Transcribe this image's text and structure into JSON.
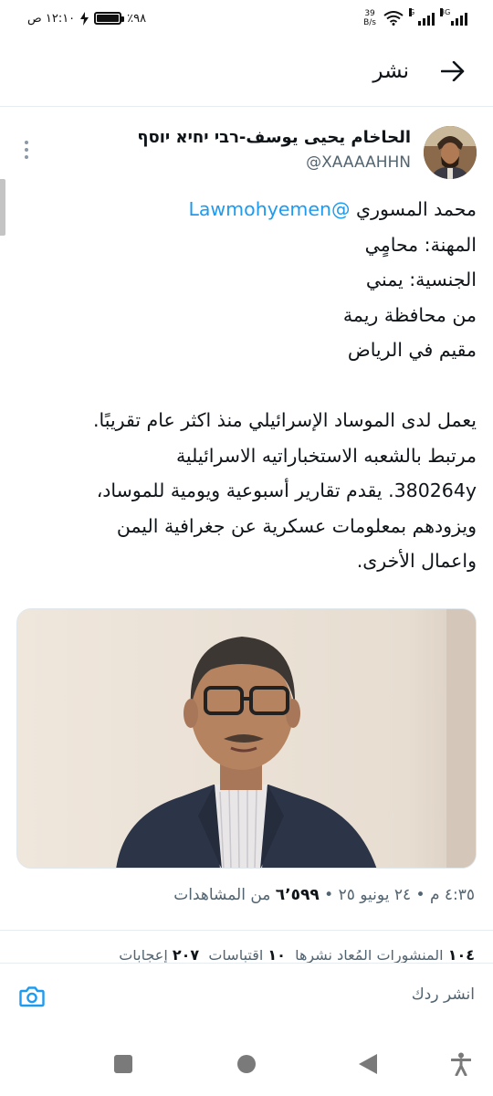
{
  "status_bar": {
    "time": "١٢:١٠ ص",
    "battery": "٪٩٨",
    "battery_level": 0.98,
    "net_speed_value": "39",
    "net_speed_unit": "B/s",
    "signal_label_1": "G",
    "signal_label_2": "3G"
  },
  "header": {
    "title": "نشر"
  },
  "tweet": {
    "author_name": "الحاخام يحيى يوسف-רבי יחיא יוסף",
    "author_handle": "@XAAAAHHN",
    "body": {
      "line1_name": "محمد المسوري ",
      "line1_mention": "@Lawmohyemen",
      "line2": "المهنة: محامٍي",
      "line3": "الجنسية: يمني",
      "line4": "من محافظة ريمة",
      "line5": "مقيم في الرياض",
      "line6": "يعمل لدى الموساد الإسرائيلي منذ اكثر عام تقريبًا.",
      "line7": "مرتبط بالشعبه الاستخباراتيه الاسرائيلية",
      "line8": "380264y. يقدم تقارير أسبوعية ويومية للموساد،",
      "line9": "ويزودهم بمعلومات عسكرية عن جغرافية اليمن",
      "line10": "واعمال الأخرى."
    },
    "meta": {
      "time": "٤:٣٥ م",
      "sep1": " • ",
      "date": "٢٤ يونيو ٢٥",
      "sep2": " • ",
      "views_count": "٦٬٥٩٩",
      "views_label": " من المشاهدات"
    },
    "stats": {
      "reposts_count": "١٠٤",
      "reposts_label": " المنشورات المُعاد نشرها",
      "quotes_count": "١٠",
      "quotes_label": " اقتباسات",
      "likes_count": "٢٠٧",
      "likes_label": " إعجابات"
    }
  },
  "reply": {
    "placeholder": "انشر ردك"
  },
  "colors": {
    "link": "#1d9bf0",
    "secondary_text": "#536471",
    "primary_text": "#0f1419"
  },
  "icons": {
    "back": "arrow-right-icon",
    "more": "more-vertical-icon",
    "camera": "camera-icon",
    "nav_recents": "square-icon",
    "nav_home": "circle-icon",
    "nav_back": "triangle-icon",
    "nav_accessibility": "accessibility-icon"
  }
}
